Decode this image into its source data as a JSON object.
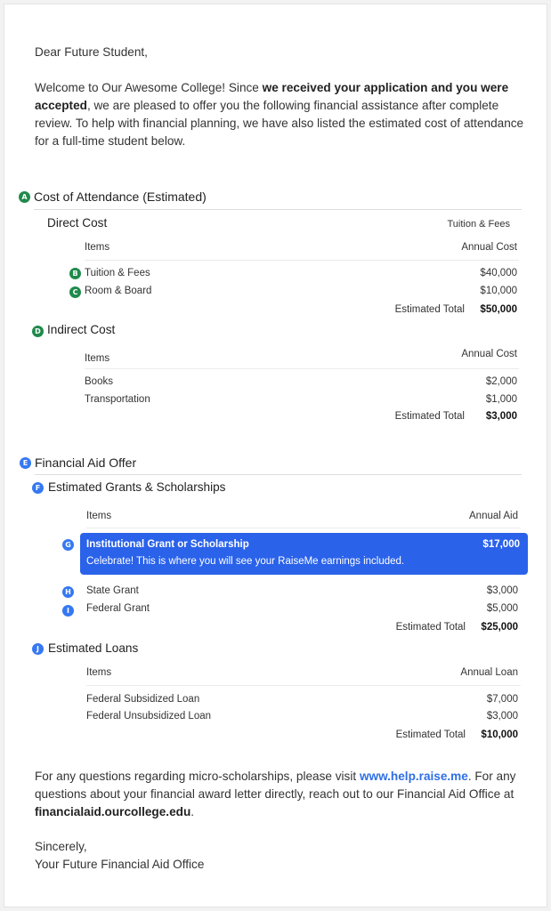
{
  "letter": {
    "greeting": "Dear Future Student,",
    "intro_1": "Welcome to Our Awesome College! Since ",
    "intro_bold": "we received your application and you were accepted",
    "intro_2": ", we are pleased to offer you the following financial assistance after complete review. To help with financial planning, we have also listed the estimated cost of attendance for a full-time student below.",
    "closing_1": "For any questions regarding micro-scholarships, please visit ",
    "closing_link": "www.help.raise.me",
    "closing_2": ". For any questions about your financial award letter directly, reach out to our Financial Aid Office at ",
    "closing_email": "financialaid.ourcollege.edu",
    "closing_3": ".",
    "signoff": "Sincerely,",
    "signature": "Your Future Financial Aid Office"
  },
  "cost_of_attendance": {
    "badge": "A",
    "title": "Cost of Attendance (Estimated)",
    "direct": {
      "title": "Direct Cost",
      "tag": "Tuition & Fees",
      "col_items": "Items",
      "col_value": "Annual Cost",
      "rows": [
        {
          "badge": "B",
          "label": "Tuition & Fees",
          "value": "$40,000"
        },
        {
          "badge": "C",
          "label": "Room & Board",
          "value": "$10,000"
        }
      ],
      "total_label": "Estimated Total",
      "total_value": "$50,000"
    },
    "indirect": {
      "badge": "D",
      "title": "Indirect Cost",
      "col_items": "Items",
      "col_value": "Annual Cost",
      "rows": [
        {
          "label": "Books",
          "value": "$2,000"
        },
        {
          "label": "Transportation",
          "value": "$1,000"
        }
      ],
      "total_label": "Estimated Total",
      "total_value": "$3,000"
    }
  },
  "financial_aid": {
    "badge": "E",
    "title": "Financial Aid Offer",
    "grants": {
      "badge": "F",
      "title": "Estimated Grants & Scholarships",
      "col_items": "Items",
      "col_value": "Annual Aid",
      "highlight": {
        "badge": "G",
        "label": "Institutional Grant or Scholarship",
        "value": "$17,000",
        "note": "Celebrate! This is where you will see your RaiseMe earnings included."
      },
      "rows": [
        {
          "badge": "H",
          "label": "State Grant",
          "value": "$3,000"
        },
        {
          "badge": "I",
          "label": "Federal Grant",
          "value": "$5,000"
        }
      ],
      "total_label": "Estimated Total",
      "total_value": "$25,000"
    },
    "loans": {
      "badge": "J",
      "title": "Estimated Loans",
      "col_items": "Items",
      "col_value": "Annual Loan",
      "rows": [
        {
          "label": "Federal Subsidized Loan",
          "value": "$7,000"
        },
        {
          "label": "Federal Unsubsidized Loan",
          "value": "$3,000"
        }
      ],
      "total_label": "Estimated Total",
      "total_value": "$10,000"
    }
  },
  "colors": {
    "badge_green": "#1f8a4c",
    "badge_blue": "#3578f2",
    "highlight_bg": "#2a62ea",
    "link": "#2e6fe6"
  }
}
